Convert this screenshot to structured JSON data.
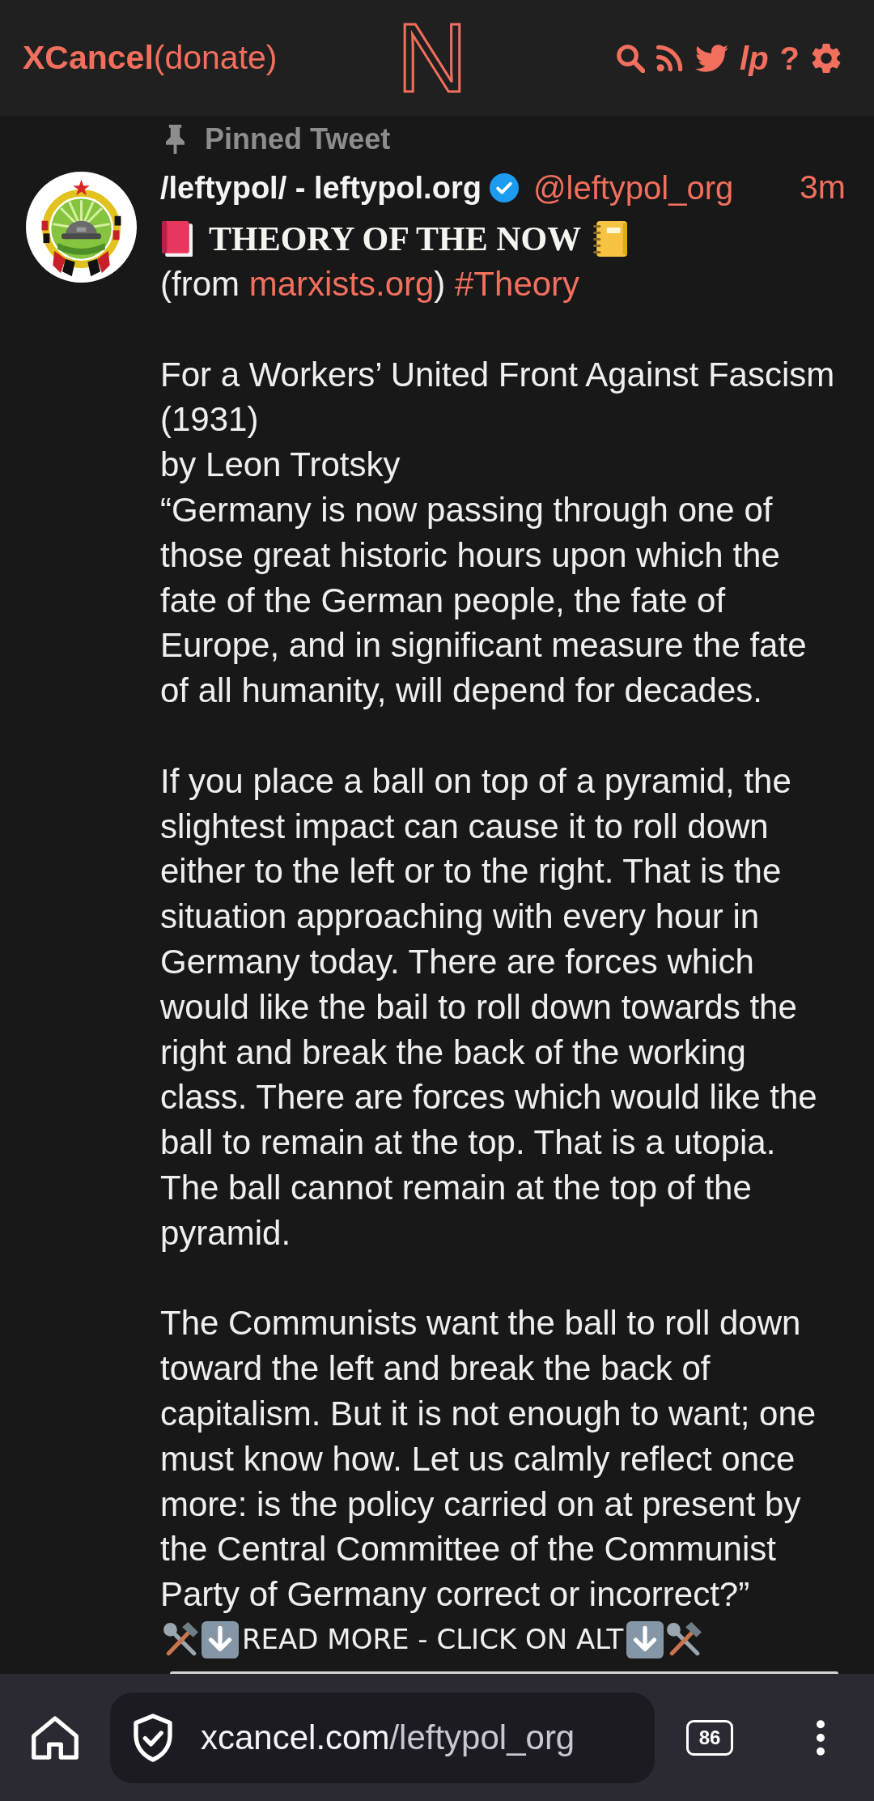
{
  "header": {
    "brand": "XCancel",
    "donate": "(donate)",
    "logo": "N",
    "nav": [
      {
        "kind": "search"
      },
      {
        "kind": "rss"
      },
      {
        "kind": "bird"
      },
      {
        "kind": "wordmark",
        "label": "lp"
      },
      {
        "kind": "glyph",
        "label": "?"
      },
      {
        "kind": "gear"
      }
    ]
  },
  "tweet": {
    "pinned": "Pinned Tweet",
    "author": {
      "name": "/leftypol/ - leftypol.org",
      "verified": true,
      "handle": "@leftypol_org"
    },
    "time": "3m",
    "heading": "THEORY OF THE NOW",
    "source": {
      "before": "(from ",
      "link": "marxists.org",
      "after": ") ",
      "hashtag": "#Theory"
    },
    "paragraphs": [
      [
        "For a Workers’ United Front Against Fascism\n(1931)",
        "by Leon Trotsky",
        "“Germany is now passing through one of\nthose great historic hours upon which the\nfate of the German people, the fate of\nEurope, and in significant measure the fate\nof all humanity, will depend for decades."
      ],
      [
        "If you place a ball on top of a pyramid, the\nslightest impact can cause it to roll down\neither to the left or to the right. That is the\nsituation approaching with every hour in\nGermany today. There are forces which\nwould like the bail to roll down towards the\nright and break the back of the working\nclass. There are forces which would like the\nball to remain at the top. That is a utopia.\nThe ball cannot remain at the top of the\npyramid."
      ],
      [
        "The Communists want the ball to roll down\ntoward the left and break the back of\ncapitalism. But it is not enough to want; one\nmust know how. Let us calmly reflect once\nmore: is the policy carried on at present by\nthe Central Committee of the Communist\nParty of Germany correct or incorrect?”"
      ]
    ],
    "read_more": "READ MORE - CLICK ON ALT"
  },
  "browser": {
    "url_host": "xcancel.com",
    "url_path": "/leftypol_org",
    "tab_count": "86"
  }
}
